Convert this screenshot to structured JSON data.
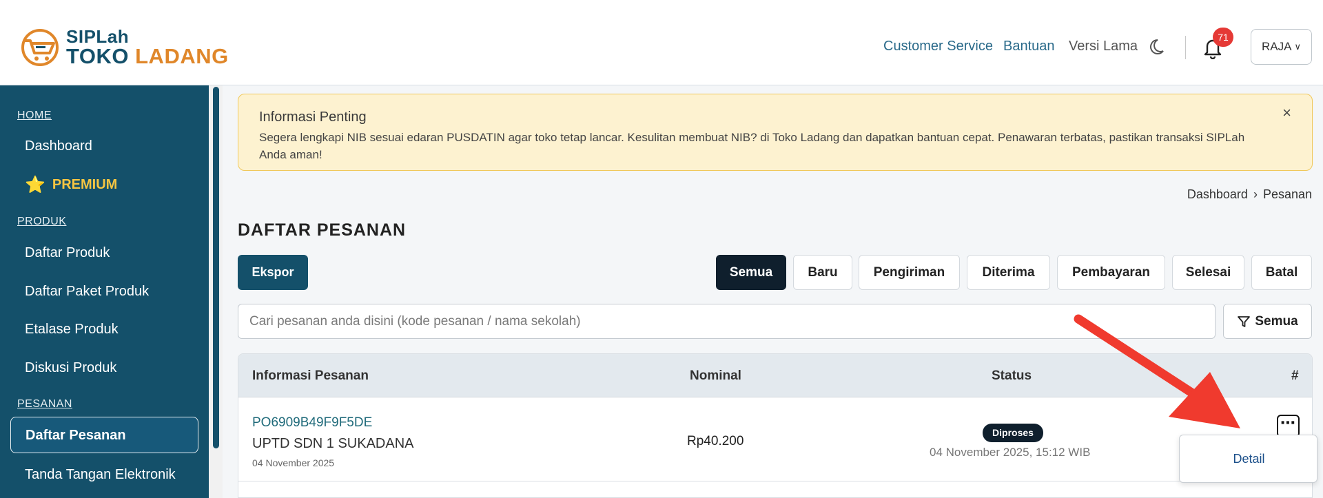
{
  "brand": {
    "line1": "SIPLah",
    "line2_a": "TOKO",
    "line2_b": "LADANG",
    "primary_color": "#14506a",
    "accent_color": "#e0872a"
  },
  "nav": {
    "customer_service": "Customer Service",
    "bantuan": "Bantuan",
    "versi_lama": "Versi Lama",
    "notification_count": "71",
    "user_label": "RAJA"
  },
  "sidebar": {
    "home_label": "HOME",
    "dashboard": "Dashboard",
    "premium": "PREMIUM",
    "produk_label": "PRODUK",
    "daftar_produk": "Daftar Produk",
    "daftar_paket_produk": "Daftar Paket Produk",
    "etalase_produk": "Etalase Produk",
    "diskusi_produk": "Diskusi Produk",
    "pesanan_label": "PESANAN",
    "daftar_pesanan": "Daftar Pesanan",
    "tanda_tangan": "Tanda Tangan Elektronik"
  },
  "alert": {
    "title": "Informasi Penting",
    "body": "Segera lengkapi NIB sesuai edaran PUSDATIN agar toko tetap lancar. Kesulitan membuat NIB? di Toko Ladang dan dapatkan bantuan cepat. Penawaran terbatas, pastikan transaksi SIPLah Anda aman!",
    "close": "×"
  },
  "breadcrumb": {
    "home": "Dashboard",
    "current": "Pesanan"
  },
  "page_title": "DAFTAR PESANAN",
  "export_label": "Ekspor",
  "filters": [
    "Semua",
    "Baru",
    "Pengiriman",
    "Diterima",
    "Pembayaran",
    "Selesai",
    "Batal"
  ],
  "search": {
    "placeholder": "Cari pesanan anda disini (kode pesanan / nama sekolah)"
  },
  "filter_all_label": "Semua",
  "table": {
    "headers": {
      "info": "Informasi Pesanan",
      "nominal": "Nominal",
      "status": "Status",
      "action": "#"
    },
    "rows": [
      {
        "code": "PO6909B49F9F5DE",
        "school": "UPTD SDN 1 SUKADANA",
        "date": "04 November 2025",
        "nominal": "Rp40.200",
        "status": "Diproses",
        "status_time": "04 November 2025, 15:12 WIB"
      }
    ]
  },
  "dropdown": {
    "detail": "Detail"
  }
}
